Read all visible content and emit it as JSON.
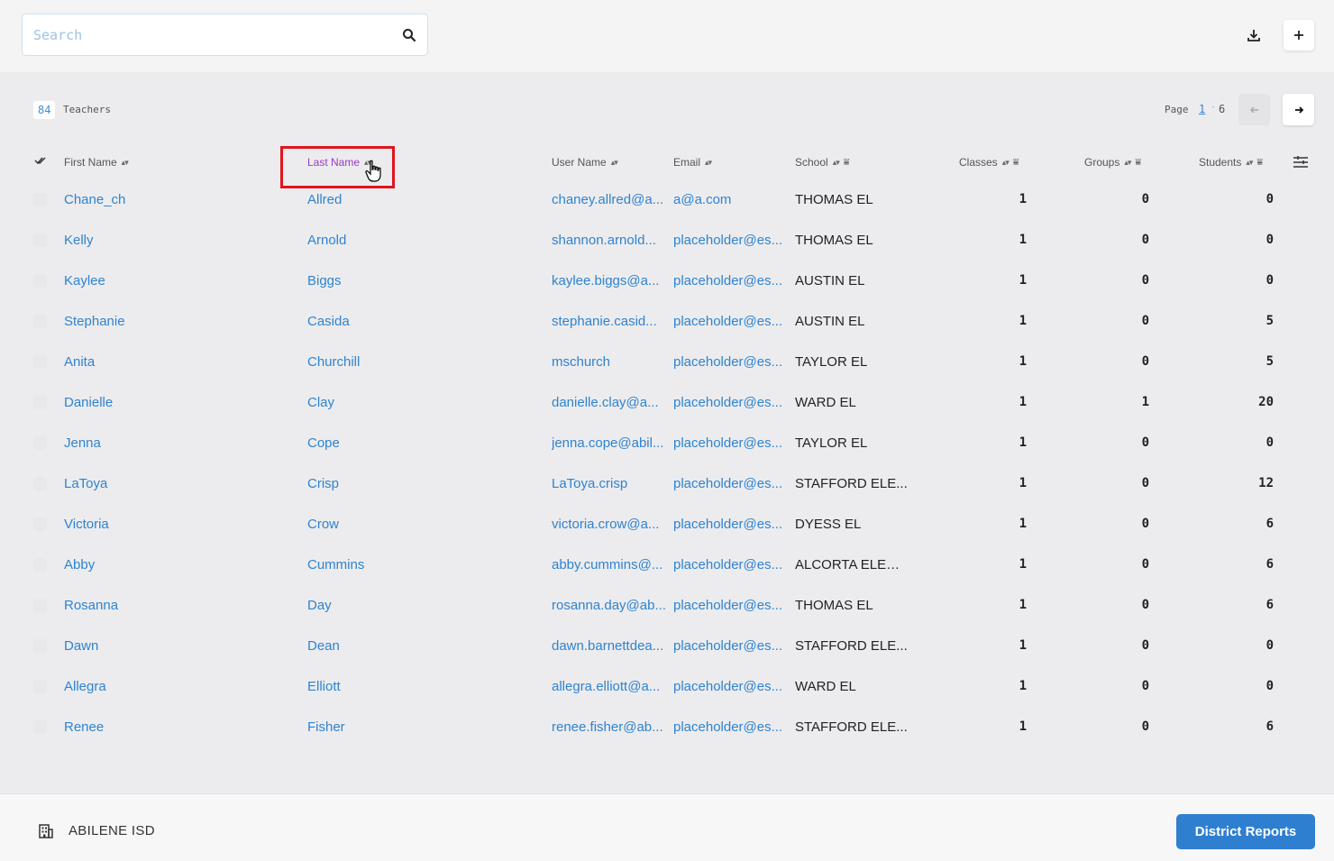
{
  "search": {
    "placeholder": "Search"
  },
  "summary": {
    "count": "84",
    "label": "Teachers"
  },
  "pagination": {
    "label": "Page",
    "current": "1",
    "separator": "·",
    "total": "6"
  },
  "columns": {
    "first_name": "First Name",
    "last_name": "Last Name",
    "user_name": "User Name",
    "email": "Email",
    "school": "School",
    "classes": "Classes",
    "groups": "Groups",
    "students": "Students"
  },
  "rows": [
    {
      "first": "Chane_ch",
      "last": "Allred",
      "user": "chaney.allred@a...",
      "email": "a@a.com",
      "school": "THOMAS EL",
      "classes": "1",
      "groups": "0",
      "students": "0"
    },
    {
      "first": "Kelly",
      "last": "Arnold",
      "user": "shannon.arnold...",
      "email": "placeholder@es...",
      "school": "THOMAS EL",
      "classes": "1",
      "groups": "0",
      "students": "0"
    },
    {
      "first": "Kaylee",
      "last": "Biggs",
      "user": "kaylee.biggs@a...",
      "email": "placeholder@es...",
      "school": "AUSTIN EL",
      "classes": "1",
      "groups": "0",
      "students": "0"
    },
    {
      "first": "Stephanie",
      "last": "Casida",
      "user": "stephanie.casid...",
      "email": "placeholder@es...",
      "school": "AUSTIN EL",
      "classes": "1",
      "groups": "0",
      "students": "5"
    },
    {
      "first": "Anita",
      "last": "Churchill",
      "user": "mschurch",
      "email": "placeholder@es...",
      "school": "TAYLOR EL",
      "classes": "1",
      "groups": "0",
      "students": "5"
    },
    {
      "first": "Danielle",
      "last": "Clay",
      "user": "danielle.clay@a...",
      "email": "placeholder@es...",
      "school": "WARD EL",
      "classes": "1",
      "groups": "1",
      "students": "20"
    },
    {
      "first": "Jenna",
      "last": "Cope",
      "user": "jenna.cope@abil...",
      "email": "placeholder@es...",
      "school": "TAYLOR EL",
      "classes": "1",
      "groups": "0",
      "students": "0"
    },
    {
      "first": "LaToya",
      "last": "Crisp",
      "user": "LaToya.crisp",
      "email": "placeholder@es...",
      "school": "STAFFORD ELE...",
      "classes": "1",
      "groups": "0",
      "students": "12"
    },
    {
      "first": "Victoria",
      "last": "Crow",
      "user": "victoria.crow@a...",
      "email": "placeholder@es...",
      "school": "DYESS EL",
      "classes": "1",
      "groups": "0",
      "students": "6"
    },
    {
      "first": "Abby",
      "last": "Cummins",
      "user": "abby.cummins@...",
      "email": "placeholder@es...",
      "school": "ALCORTA ELEM...",
      "classes": "1",
      "groups": "0",
      "students": "6"
    },
    {
      "first": "Rosanna",
      "last": "Day",
      "user": "rosanna.day@ab...",
      "email": "placeholder@es...",
      "school": "THOMAS EL",
      "classes": "1",
      "groups": "0",
      "students": "6"
    },
    {
      "first": "Dawn",
      "last": "Dean",
      "user": "dawn.barnettdea...",
      "email": "placeholder@es...",
      "school": "STAFFORD ELE...",
      "classes": "1",
      "groups": "0",
      "students": "0"
    },
    {
      "first": "Allegra",
      "last": "Elliott",
      "user": "allegra.elliott@a...",
      "email": "placeholder@es...",
      "school": "WARD EL",
      "classes": "1",
      "groups": "0",
      "students": "0"
    },
    {
      "first": "Renee",
      "last": "Fisher",
      "user": "renee.fisher@ab...",
      "email": "placeholder@es...",
      "school": "STAFFORD ELE...",
      "classes": "1",
      "groups": "0",
      "students": "6"
    }
  ],
  "footer": {
    "district": "ABILENE ISD",
    "reports_label": "District Reports"
  },
  "icons": {
    "search": "search-icon",
    "download": "download-icon",
    "add": "plus-icon",
    "prev": "arrow-left-icon",
    "next": "arrow-right-icon",
    "columns": "column-settings-icon",
    "building": "building-icon",
    "cursor": "hand-cursor-icon"
  },
  "colors": {
    "link": "#2f83d0",
    "active_sort": "#9b37c9",
    "primary_button": "#2f7fd1",
    "highlight": "#e0141e"
  }
}
